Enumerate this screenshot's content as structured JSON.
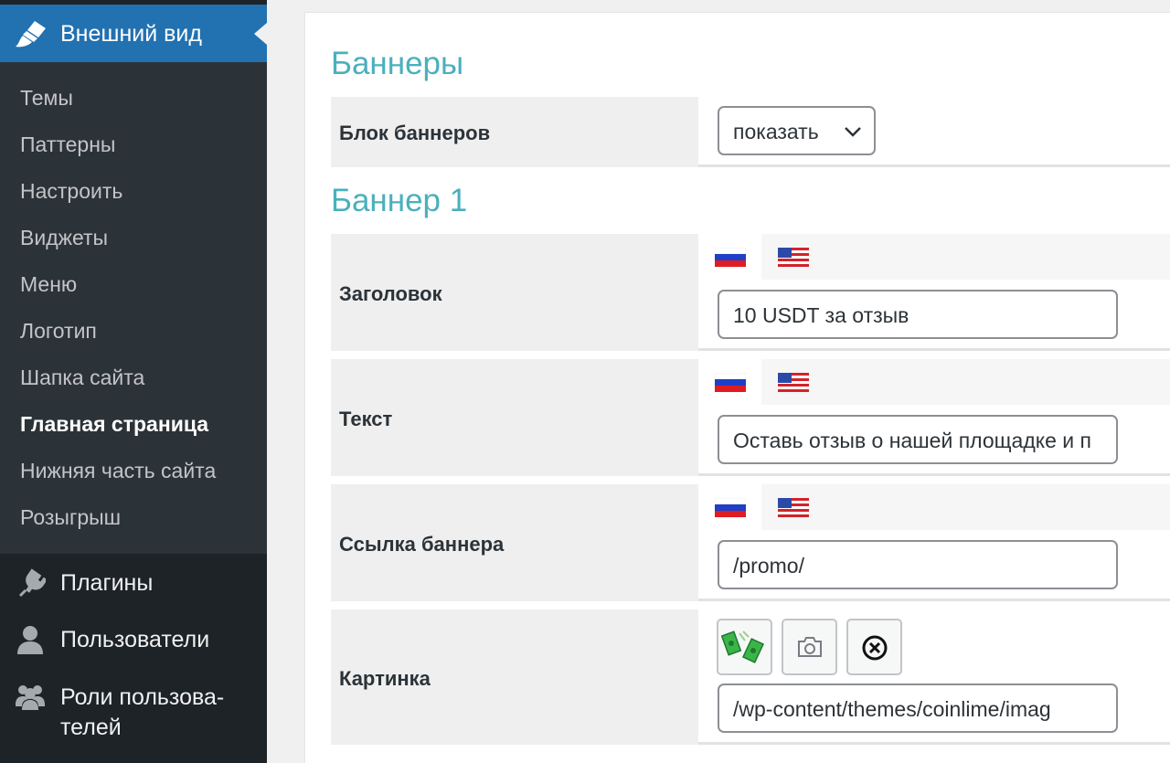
{
  "sidebar": {
    "active_menu": {
      "label": "Внешний вид",
      "icon": "paintbrush-icon"
    },
    "submenu": [
      {
        "label": "Темы"
      },
      {
        "label": "Паттерны"
      },
      {
        "label": "Настроить"
      },
      {
        "label": "Виджеты"
      },
      {
        "label": "Меню"
      },
      {
        "label": "Логотип"
      },
      {
        "label": "Шапка сайта"
      },
      {
        "label": "Главная страница",
        "current": true
      },
      {
        "label": "Нижняя часть сайта"
      },
      {
        "label": "Розыгрыш"
      }
    ],
    "menu": [
      {
        "label": "Плагины",
        "icon": "plugins-icon"
      },
      {
        "label": "Пользователи",
        "icon": "user-icon"
      },
      {
        "label": "Роли пользова-",
        "label2": "телей",
        "icon": "users-group-icon"
      }
    ]
  },
  "main": {
    "section_banners": "Баннеры",
    "banner_block": {
      "label": "Блок баннеров",
      "selected": "показать"
    },
    "section_banner1": "Баннер 1",
    "title_field": {
      "label": "Заголовок",
      "value": "10 USDT за отзыв"
    },
    "text_field": {
      "label": "Текст",
      "value": "Оставь отзыв о нашей площадке и п"
    },
    "link_field": {
      "label": "Ссылка баннера",
      "value": "/promo/"
    },
    "image_field": {
      "label": "Картинка",
      "value": "/wp-content/themes/coinlime/imag"
    },
    "languages": [
      "ru-flag-icon",
      "us-flag-icon"
    ],
    "colors": {
      "accent": "#4ab0bd",
      "sidebar": "#1d2327",
      "active": "#2271b1"
    }
  }
}
